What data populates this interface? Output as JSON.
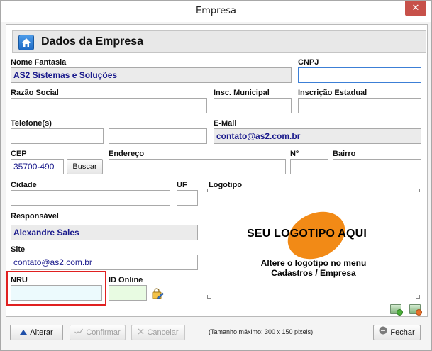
{
  "window": {
    "title": "Empresa",
    "close_glyph": "✕"
  },
  "header": {
    "title": "Dados da Empresa",
    "icon": "home-icon"
  },
  "fields": {
    "nome_fantasia": {
      "label": "Nome Fantasia",
      "value": "AS2 Sistemas e Soluções"
    },
    "cnpj": {
      "label": "CNPJ",
      "value": ""
    },
    "razao_social": {
      "label": "Razão Social",
      "value": ""
    },
    "insc_municipal": {
      "label": "Insc. Municipal",
      "value": ""
    },
    "inscricao_estadual": {
      "label": "Inscrição Estadual",
      "value": ""
    },
    "telefones": {
      "label": "Telefone(s)",
      "value1": "",
      "value2": ""
    },
    "email": {
      "label": "E-Mail",
      "value": "contato@as2.com.br"
    },
    "cep": {
      "label": "CEP",
      "value": "35700-490",
      "button": "Buscar"
    },
    "endereco": {
      "label": "Endereço",
      "value": ""
    },
    "numero": {
      "label": "Nº",
      "value": ""
    },
    "bairro": {
      "label": "Bairro",
      "value": ""
    },
    "cidade": {
      "label": "Cidade",
      "value": ""
    },
    "uf": {
      "label": "UF",
      "value": ""
    },
    "responsavel": {
      "label": "Responsável",
      "value": "Alexandre Sales"
    },
    "site": {
      "label": "Site",
      "value": "contato@as2.com.br"
    },
    "nru": {
      "label": "NRU",
      "value": ""
    },
    "id_online": {
      "label": "ID Online",
      "value": ""
    }
  },
  "logo": {
    "label": "Logotipo",
    "placeholder_text": "SEU LOGOTIPO AQUI",
    "line1": "Altere o logotipo no menu",
    "line2": "Cadastros / Empresa",
    "note": "(Tamanho máximo:  300 x 150 pixels)",
    "accent": "#f28a16"
  },
  "footer": {
    "alterar": "Alterar",
    "confirmar": "Confirmar",
    "cancelar": "Cancelar",
    "fechar": "Fechar"
  }
}
